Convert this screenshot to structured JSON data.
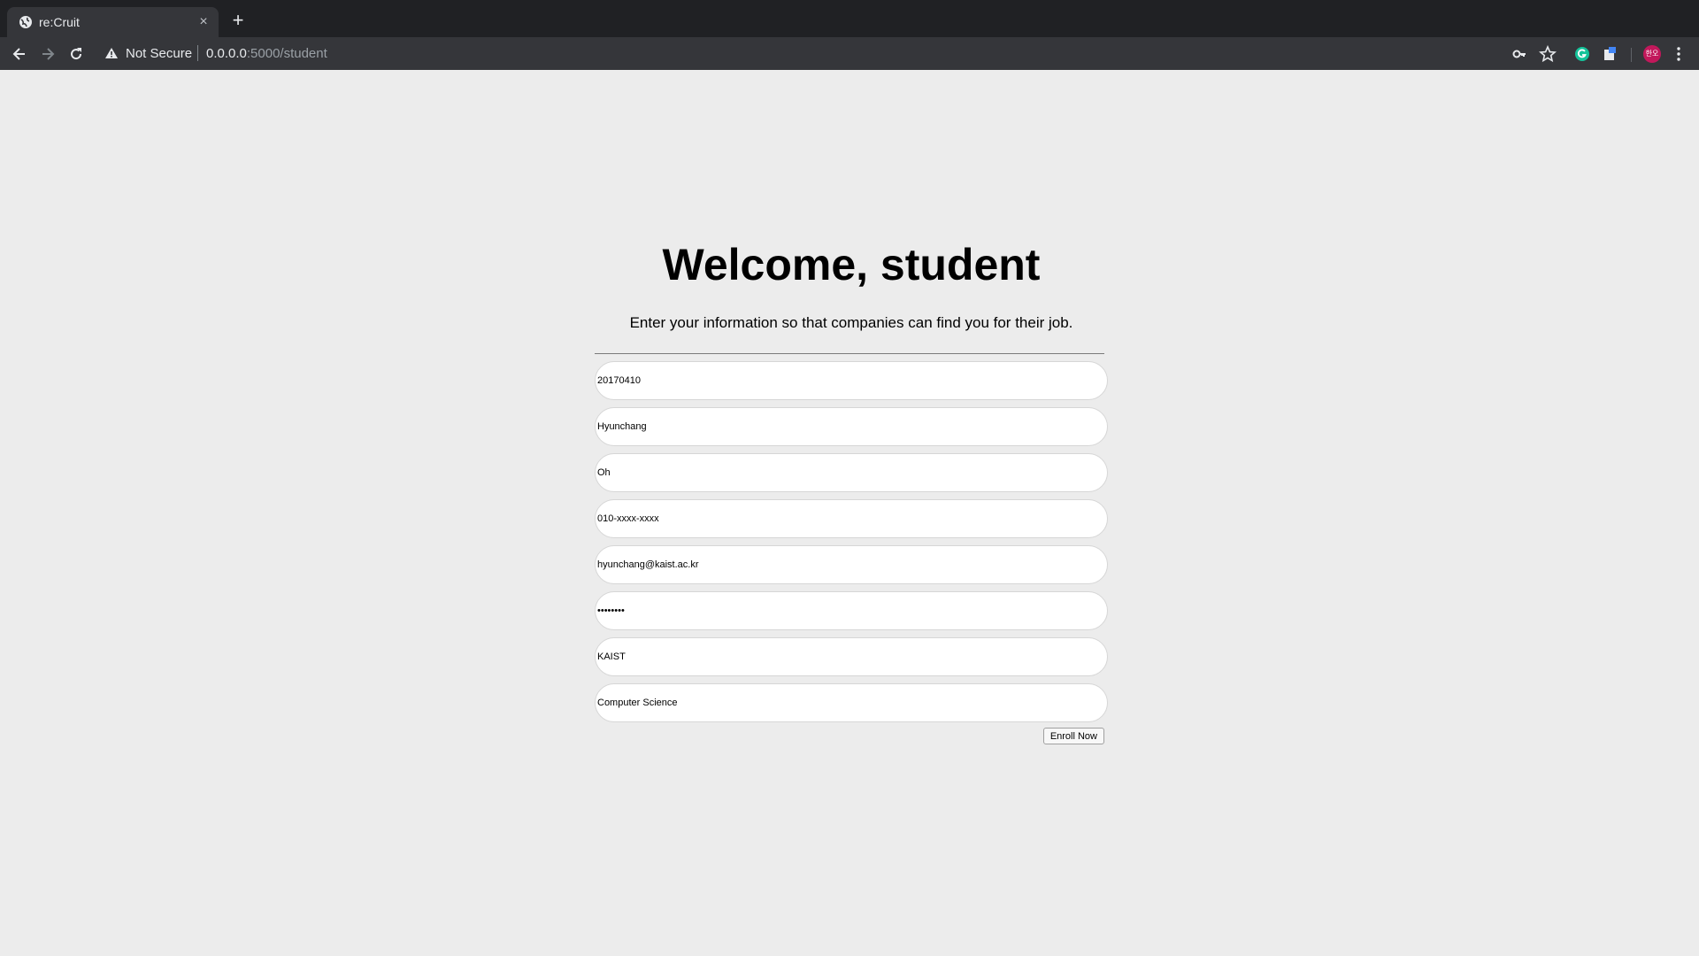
{
  "browser": {
    "tab_title": "re:Cruit",
    "tab_close": "×",
    "new_tab": "+",
    "security_label": "Not Secure",
    "url_host": "0.0.0.0",
    "url_path": ":5000/student",
    "avatar_text": "한오"
  },
  "page": {
    "title": "Welcome, student",
    "subtitle": "Enter your information so that companies can find you for their job.",
    "fields": [
      {
        "value": "20170410"
      },
      {
        "value": "Hyunchang"
      },
      {
        "value": "Oh"
      },
      {
        "value": "010-xxxx-xxxx"
      },
      {
        "value": "hyunchang@kaist.ac.kr"
      },
      {
        "value": "••••••••"
      },
      {
        "value": "KAIST"
      },
      {
        "value": "Computer Science"
      }
    ],
    "submit_label": "Enroll Now"
  }
}
